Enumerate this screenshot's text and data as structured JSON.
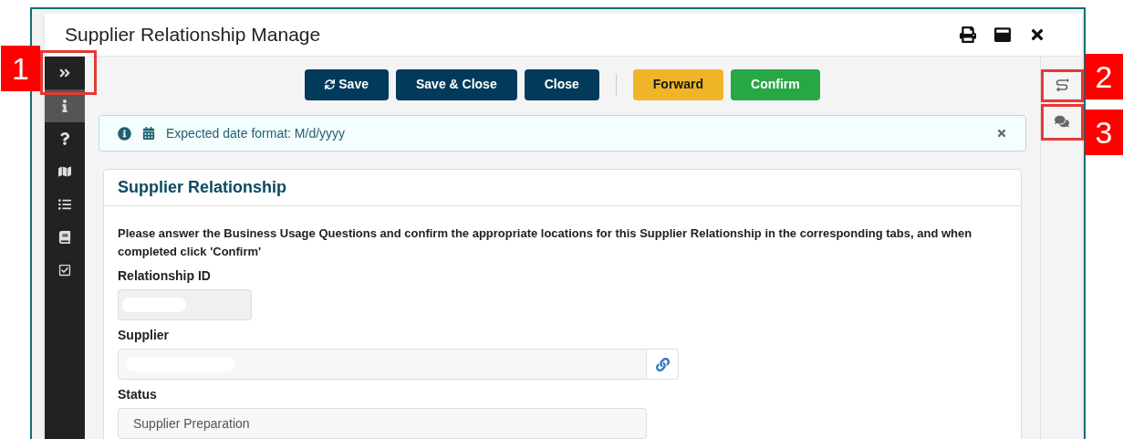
{
  "dialog": {
    "title": "Supplier Relationship Manage"
  },
  "sidebar": {
    "items": [
      {
        "kind": "expand",
        "selected": false
      },
      {
        "kind": "info",
        "selected": true
      },
      {
        "kind": "help",
        "selected": false
      },
      {
        "kind": "map",
        "selected": false
      },
      {
        "kind": "list",
        "selected": false
      },
      {
        "kind": "book",
        "selected": false
      },
      {
        "kind": "check",
        "selected": false
      }
    ]
  },
  "toolbar": {
    "buttons": [
      {
        "label": "Save",
        "kind": "primary"
      },
      {
        "label": "Save & Close",
        "kind": "primary"
      },
      {
        "label": "Close",
        "kind": "primary"
      },
      {
        "kind": "divider"
      },
      {
        "label": "Forward",
        "kind": "warning"
      },
      {
        "label": "Confirm",
        "kind": "success"
      }
    ]
  },
  "alert": {
    "text": "Expected date format: M/d/yyyy"
  },
  "section": {
    "title": "Supplier Relationship",
    "instructions": "Please answer the Business Usage Questions and confirm the appropriate locations for this Supplier Relationship in the corresponding tabs, and when completed click 'Confirm'",
    "fields": [
      {
        "label": "Relationship ID",
        "kind": "redacted-short"
      },
      {
        "label": "Supplier",
        "kind": "redacted-link"
      },
      {
        "label": "Status",
        "kind": "text",
        "value": "Supplier Preparation"
      }
    ]
  },
  "callouts": [
    {
      "number": "1"
    },
    {
      "number": "2"
    },
    {
      "number": "3"
    }
  ]
}
